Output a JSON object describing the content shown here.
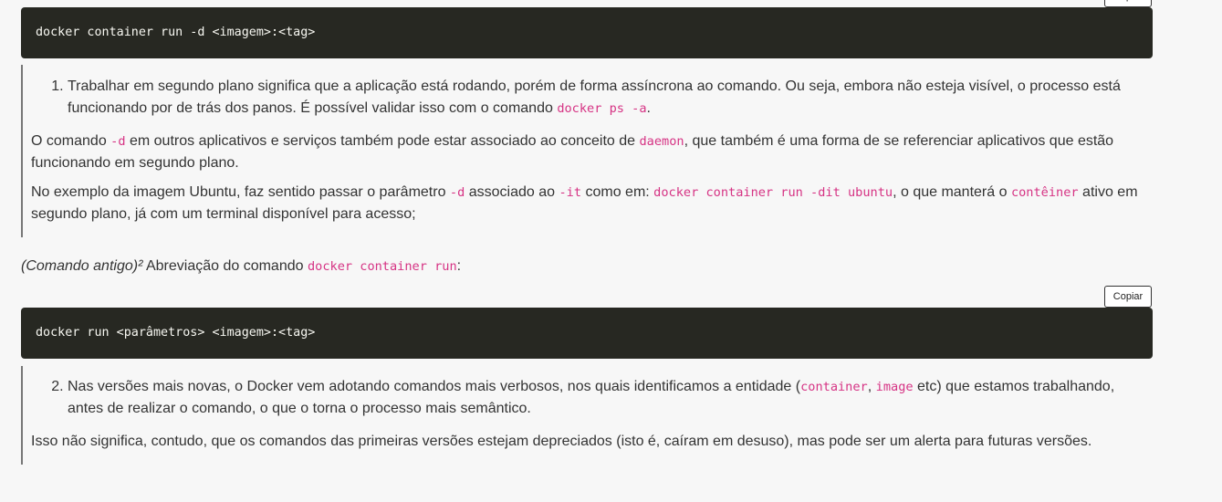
{
  "copy_label": "Copiar",
  "code1": "docker container run -d <imagem>:<tag>",
  "quote1": {
    "item_number": "1.",
    "item_text_a": "Trabalhar em segundo plano significa que a aplicação está rodando, porém de forma assíncrona ao comando. Ou seja, embora não esteja visível, o processo está funcionando por de trás dos panos. É possível validar isso com o comando ",
    "item_code": "docker ps -a",
    "item_text_b": ".",
    "p1_a": "O comando ",
    "p1_code1": "-d",
    "p1_b": " em outros aplicativos e serviços também pode estar associado ao conceito de ",
    "p1_code2": "daemon",
    "p1_c": ", que também é uma forma de se referenciar aplicativos que estão funcionando em segundo plano.",
    "p2_a": "No exemplo da imagem Ubuntu, faz sentido passar o parâmetro ",
    "p2_code1": "-d",
    "p2_b": " associado ao ",
    "p2_code2": "-it",
    "p2_c": " como em: ",
    "p2_code3": "docker container run -dit ubuntu",
    "p2_d": ", o que manterá o ",
    "p2_code4": "contêiner",
    "p2_e": " ativo em segundo plano, já com um terminal disponível para acesso;"
  },
  "para_old": {
    "em": "(Comando antigo)²",
    "text": " Abreviação do comando ",
    "code": "docker container run",
    "end": ":"
  },
  "code2": "docker run <parâmetros> <imagem>:<tag>",
  "quote2": {
    "item_text_a": "Nas versões mais novas, o Docker vem adotando comandos mais verbosos, nos quais identificamos a entidade (",
    "item_code1": "container",
    "item_sep": ", ",
    "item_code2": "image",
    "item_text_b": " etc) que estamos trabalhando, antes de realizar o comando, o que o torna o processo mais semântico.",
    "p1": "Isso não significa, contudo, que os comandos das primeiras versões estejam depreciados (isto é, caíram em desuso), mas pode ser um alerta para futuras versões."
  }
}
